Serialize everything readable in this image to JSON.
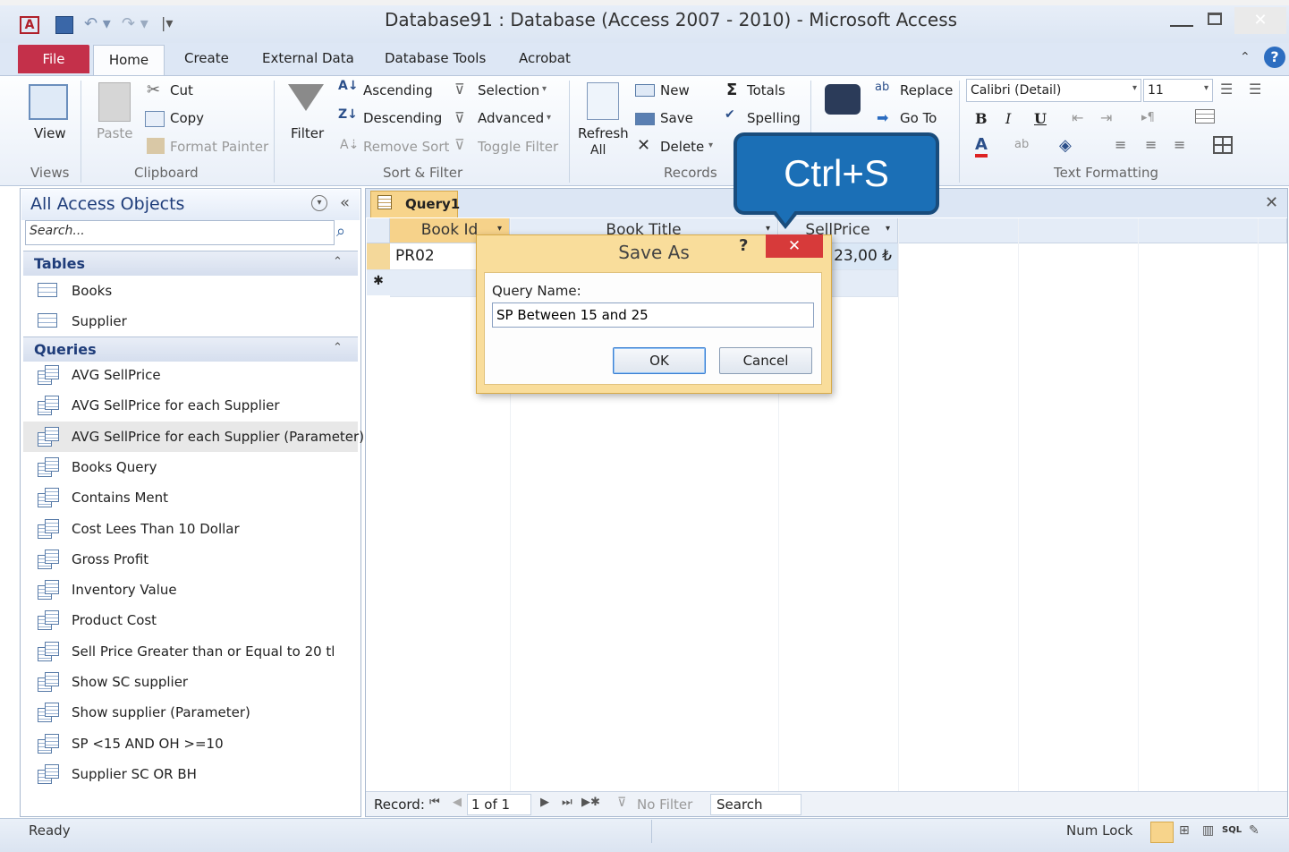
{
  "window": {
    "title": "Database91 : Database (Access 2007 - 2010)  -  Microsoft Access"
  },
  "tabs": [
    "File",
    "Home",
    "Create",
    "External Data",
    "Database Tools",
    "Acrobat"
  ],
  "ribbon": {
    "views": {
      "view": "View",
      "group": "Views"
    },
    "clipboard": {
      "paste": "Paste",
      "cut": "Cut",
      "copy": "Copy",
      "format_painter": "Format Painter",
      "group": "Clipboard"
    },
    "sort_filter": {
      "filter": "Filter",
      "ascending": "Ascending",
      "descending": "Descending",
      "remove_sort": "Remove Sort",
      "selection": "Selection",
      "advanced": "Advanced",
      "toggle_filter": "Toggle Filter",
      "group": "Sort & Filter"
    },
    "records": {
      "refresh": "Refresh",
      "refresh_all": "All",
      "new": "New",
      "save": "Save",
      "delete": "Delete",
      "totals": "Totals",
      "spelling": "Spelling",
      "group": "Records"
    },
    "find": {
      "replace": "Replace",
      "goto": "Go To"
    },
    "text_formatting": {
      "font": "Calibri (Detail)",
      "size": "11",
      "bold": "B",
      "italic": "I",
      "underline": "U",
      "group": "Text Formatting"
    }
  },
  "nav": {
    "title": "All Access Objects",
    "search_placeholder": "Search...",
    "sections": {
      "tables": {
        "label": "Tables",
        "items": [
          "Books",
          "Supplier"
        ]
      },
      "queries": {
        "label": "Queries",
        "items": [
          "AVG SellPrice",
          "AVG SellPrice for each Supplier",
          "AVG SellPrice for each Supplier (Parameter)",
          "Books Query",
          "Contains Ment",
          "Cost Lees Than 10 Dollar",
          "Gross Profit",
          "Inventory Value",
          "Product Cost",
          "Sell Price Greater than or Equal to 20 tl",
          "Show SC supplier",
          "Show supplier (Parameter)",
          "SP <15 AND OH >=10",
          "Supplier SC OR BH"
        ]
      }
    }
  },
  "document": {
    "tab": "Query1",
    "columns": [
      "Book Id",
      "Book Title",
      "SellPrice"
    ],
    "rows": [
      [
        "PR02",
        "",
        "23,00 ₺"
      ]
    ],
    "new_row_marker": "✱"
  },
  "record_nav": {
    "label": "Record:",
    "position": "1 of 1",
    "filter": "No Filter",
    "search": "Search"
  },
  "status": {
    "left": "Ready",
    "num_lock": "Num Lock"
  },
  "dialog": {
    "title": "Save As",
    "help": "?",
    "close": "✕",
    "field_label": "Query Name:",
    "field_value": "SP Between 15 and 25",
    "ok": "OK",
    "cancel": "Cancel"
  },
  "callout": {
    "text": "Ctrl+S"
  }
}
